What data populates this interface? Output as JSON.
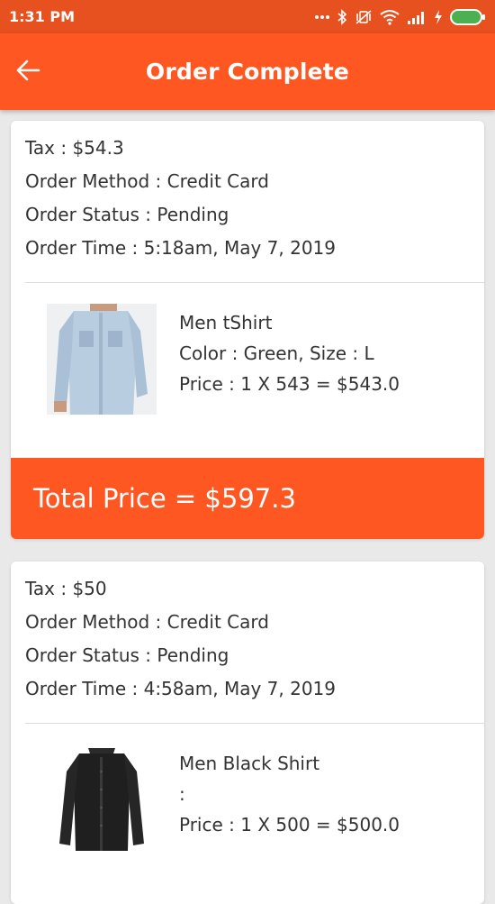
{
  "status_bar": {
    "time": "1:31 PM",
    "icons": [
      "more-dots-icon",
      "bluetooth-icon",
      "vibrate-icon",
      "wifi-icon",
      "signal-icon",
      "charging-icon",
      "battery-icon"
    ]
  },
  "app_bar": {
    "title": "Order Complete",
    "back_icon": "arrow-back-icon"
  },
  "colors": {
    "accent": "#ff5722",
    "status_bar": "#e6511f",
    "background": "#e9e9e9",
    "text": "#333333",
    "battery": "#4caf50"
  },
  "orders": [
    {
      "tax": "Tax : $54.3",
      "method": "Order Method : Credit Card",
      "status": "Order Status : Pending",
      "time": "Order Time : 5:18am, May 7, 2019",
      "items": [
        {
          "name": "Men tShirt",
          "options": "Color : Green, Size : L",
          "price": "Price : 1 X 543 = $543.0",
          "image": "light-denim-shirt-image"
        }
      ],
      "total": "Total Price = $597.3"
    },
    {
      "tax": "Tax : $50",
      "method": "Order Method : Credit Card",
      "status": "Order Status : Pending",
      "time": "Order Time : 4:58am, May 7, 2019",
      "items": [
        {
          "name": "Men Black Shirt",
          "options": ":",
          "price": "Price : 1 X 500 = $500.0",
          "image": "black-shirt-image"
        }
      ]
    }
  ]
}
